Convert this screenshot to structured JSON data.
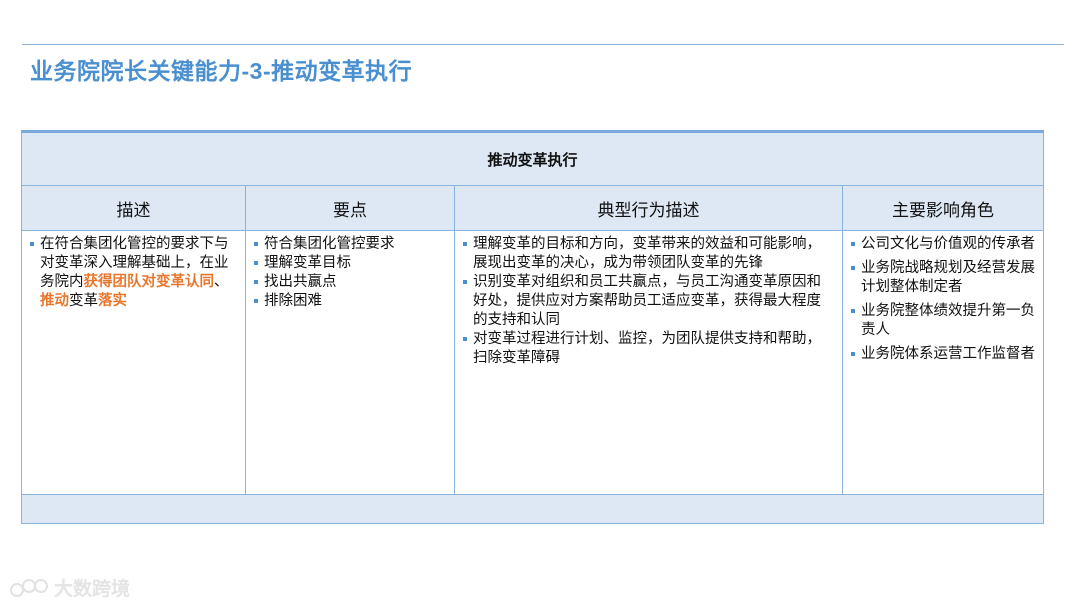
{
  "page": {
    "title": "业务院院长关键能力-3-推动变革执行"
  },
  "table": {
    "banner": "推动变革执行",
    "headers": [
      "描述",
      "要点",
      "典型行为描述",
      "主要影响角色"
    ],
    "description": {
      "part1": "在符合集团化管控的要求下与对变革深入理解基础上，在业务院内",
      "hl1": "获得团队对变革认同",
      "part2": "、",
      "hl2": "推动",
      "part3": "变革",
      "hl3": "落实"
    },
    "points": [
      "符合集团化管控要求",
      "理解变革目标",
      "找出共赢点",
      "排除困难"
    ],
    "behaviors": [
      "理解变革的目标和方向，变革带来的效益和可能影响，展现出变革的决心，成为带领团队变革的先锋",
      "识别变革对组织和员工共赢点，与员工沟通变革原因和好处，提供应对方案帮助员工适应变革，获得最大程度的支持和认同",
      "对变革过程进行计划、监控，为团队提供支持和帮助，扫除变革障碍"
    ],
    "roles": [
      "公司文化与价值观的传承者",
      "业务院战略规划及经营发展计划整体制定者",
      "业务院整体绩效提升第一负责人",
      "业务院体系运营工作监督者"
    ]
  },
  "watermark": {
    "text": "大数跨境"
  },
  "colors": {
    "title": "#4a8fd0",
    "highlight": "#e8772e",
    "header_bg": "#dde8f4",
    "border": "#8ab4de"
  }
}
